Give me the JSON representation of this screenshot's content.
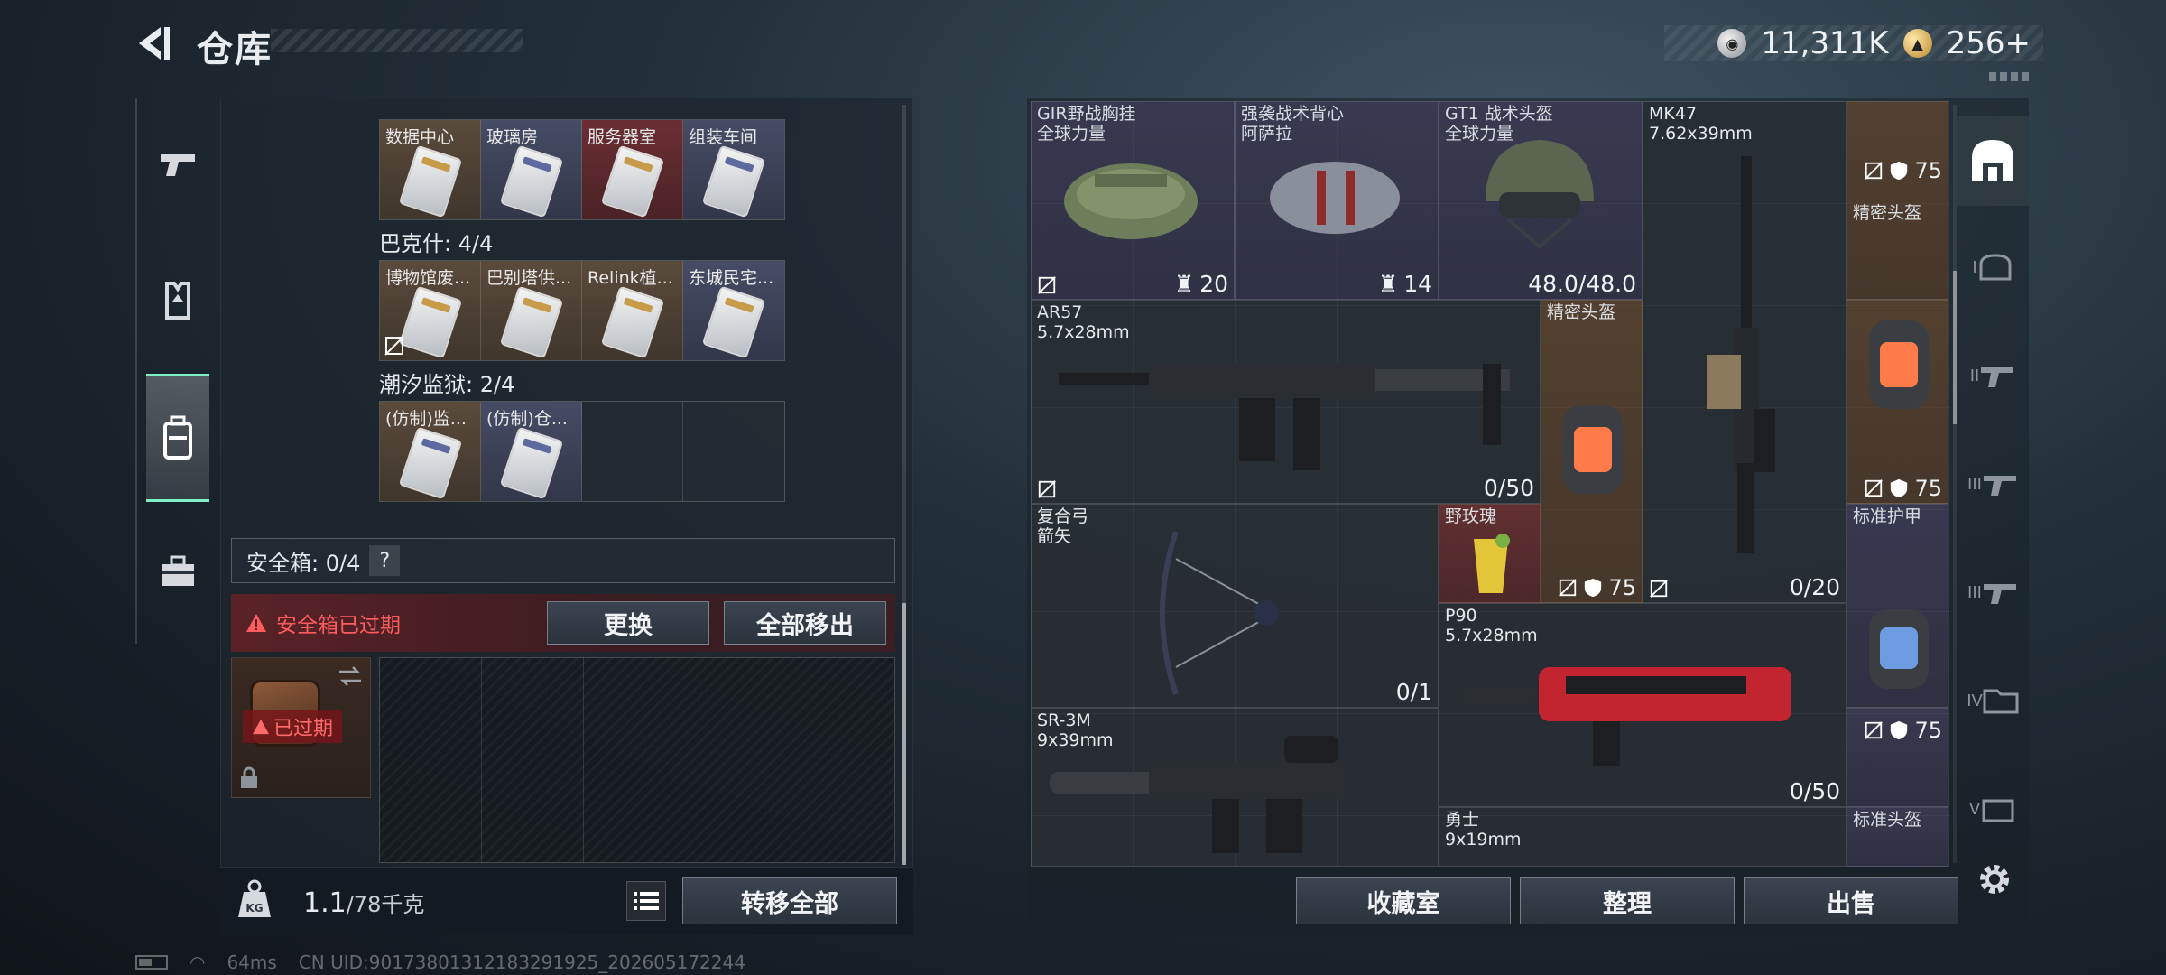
{
  "header": {
    "title": "仓库"
  },
  "currency": {
    "silver": "11,311K",
    "gold": "256",
    "gold_plus": "+"
  },
  "left": {
    "section_partial_label": "",
    "group1": {
      "cards": [
        {
          "name": "数据中心",
          "tone": "tan"
        },
        {
          "name": "玻璃房",
          "tone": "blue"
        },
        {
          "name": "服务器室",
          "tone": "red"
        },
        {
          "name": "组装车间",
          "tone": "blue"
        }
      ]
    },
    "group2": {
      "label": "巴克什: 4/4",
      "cards": [
        {
          "name": "博物馆废...",
          "tone": "tan"
        },
        {
          "name": "巴别塔供...",
          "tone": "tan"
        },
        {
          "name": "Relink植...",
          "tone": "tan"
        },
        {
          "name": "东城民宅...",
          "tone": "blue"
        }
      ]
    },
    "group3": {
      "label": "潮汐监狱: 2/4",
      "cards": [
        {
          "name": "(仿制)监...",
          "tone": "tan"
        },
        {
          "name": "(仿制)仓...",
          "tone": "blue"
        }
      ]
    },
    "safebox": {
      "label": "安全箱: 0/4",
      "help": "?",
      "expired_msg": "安全箱已过期",
      "replace_btn": "更换",
      "move_all_btn": "全部移出",
      "expired_tag": "已过期"
    },
    "footer": {
      "weight": "1.1",
      "capacity": "/78千克",
      "transfer_all": "转移全部"
    }
  },
  "stash": {
    "items": [
      {
        "name": "GIR野战胸挂",
        "sub": "全球力量",
        "value": "20"
      },
      {
        "name": "强袭战术背心",
        "sub": "阿萨拉",
        "value": "14"
      },
      {
        "name": "GT1 战术头盔",
        "sub": "全球力量",
        "value": "48.0/48.0"
      },
      {
        "name": "MK47",
        "sub": "7.62x39mm",
        "value": "0/20"
      },
      {
        "name": "精密头盔",
        "value": "75"
      },
      {
        "name": "AR57",
        "sub": "5.7x28mm",
        "value": "0/50"
      },
      {
        "name": "精密头盔",
        "value": "75"
      },
      {
        "name": "精密头盔",
        "value": "75"
      },
      {
        "name": "复合弓",
        "sub": "箭矢",
        "value": "0/1"
      },
      {
        "name": "野玫瑰"
      },
      {
        "name": "标准护甲"
      },
      {
        "name": "P90",
        "sub": "5.7x28mm",
        "value": "0/50"
      },
      {
        "name": "标准头盔",
        "value": "75"
      },
      {
        "name": "SR-3M",
        "sub": "9x39mm"
      },
      {
        "name": "勇士",
        "sub": "9x19mm"
      },
      {
        "name": "标准头盔"
      }
    ],
    "buttons": {
      "collection": "收藏室",
      "organize": "整理",
      "sell": "出售"
    },
    "side_tabs": [
      "",
      "I",
      "II",
      "III",
      "III",
      "IV",
      "V"
    ]
  },
  "status": {
    "ping": "64ms",
    "uid": "CN UID:90173801312183291925_202605172244"
  }
}
